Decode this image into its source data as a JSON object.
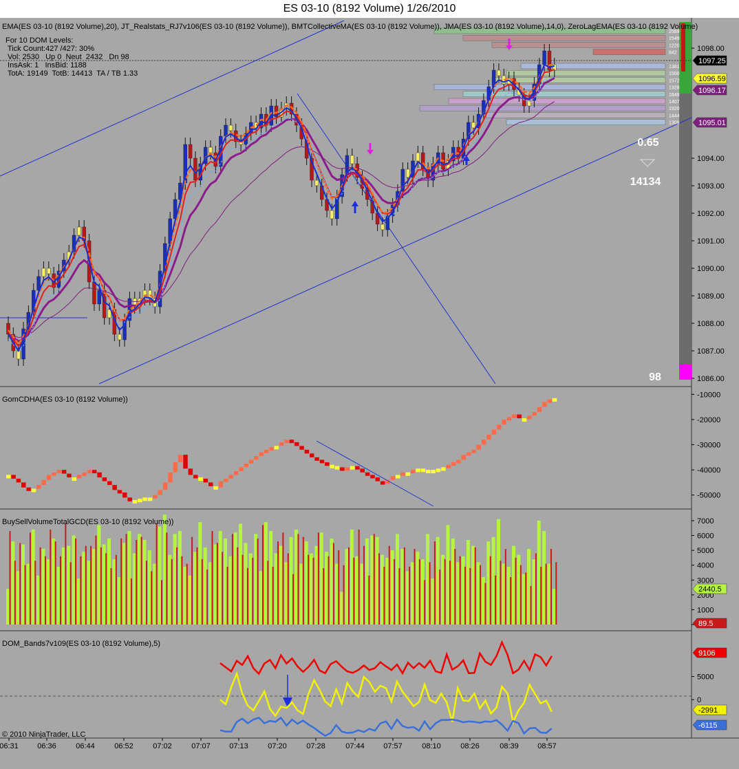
{
  "window": {
    "title": "ES 03-10 (8192 Volume)  1/26/2010"
  },
  "colors": {
    "background": "#a7a7a7",
    "up_bar": "#1a2fb8",
    "down_bar": "#b51a1a",
    "neutral_bar": "#f4ee6c",
    "ema": "#e02020",
    "jma": "#8b1c8b",
    "zlema": "#1530d0",
    "trend_line": "#2233cc",
    "cd_up": "#ff6b4a",
    "cd_down": "#e00000",
    "buy": "#b5f542",
    "sell": "#c81a1a",
    "dom_red": "#ee0000",
    "dom_yellow": "#f3f300",
    "dom_blue": "#3b6fd8"
  },
  "price_panel": {
    "indicator_label": "EMA(ES 03-10 (8192 Volume),20), JT_Realstats_RJ7v106(ES 03-10 (8192 Volume)), BMTCollectiveMA(ES 03-10 (8192 Volume)), JMA(ES 03-10 (8192 Volume),14,0), ZeroLagEMA(ES 03-10 (8192 Volume)",
    "stats": [
      "For 10 DOM Levels:",
      " Tick Count:427 /427: 30%",
      " Vol: 2530   Up 0  Neut  2432   Dn 98",
      " InsAsk: 1   InsBid: 1188",
      " TotA: 19149  TotB: 14413  TA / TB 1.33"
    ],
    "ratio": "0.65",
    "bid_total": "14134",
    "down_volume": "98",
    "dom_levels": [
      "2589",
      "1549",
      "1220",
      "842",
      "",
      "1381",
      "1500",
      "1572",
      "1328",
      "1849",
      "1407",
      "1920",
      "1444",
      "1309"
    ],
    "price_ticks": [
      "1098.00",
      "1094.00",
      "1093.00",
      "1092.00",
      "1091.00",
      "1090.00",
      "1089.00",
      "1088.00",
      "1087.00",
      "1086.00"
    ],
    "markers": [
      {
        "label": "1097.25",
        "color": "#000000",
        "text_color": "#ffffff"
      },
      {
        "label": "1096.59",
        "color": "#ffff33",
        "text_color": "#000000"
      },
      {
        "label": "1096.17",
        "color": "#7d1f7d",
        "text_color": "#ffffff"
      },
      {
        "label": "1095.01",
        "color": "#7d1f7d",
        "text_color": "#ffffff"
      }
    ]
  },
  "cd_panel": {
    "label": "GomCDHA(ES 03-10 (8192 Volume))",
    "ticks": [
      "-10000",
      "-20000",
      "-30000",
      "-40000",
      "-50000"
    ]
  },
  "vol_panel": {
    "label": "BuySellVolumeTotalGCD(ES 03-10 (8192 Volume))",
    "ticks": [
      "7000",
      "6000",
      "5000",
      "4000",
      "3000",
      "2000",
      "1000",
      "0"
    ],
    "markers": [
      {
        "label": "2440.5",
        "color": "#b5f542",
        "text_color": "#000000"
      },
      {
        "label": "89.5",
        "color": "#c81a1a",
        "text_color": "#ffffff"
      }
    ]
  },
  "dom_panel": {
    "label": "DOM_Bands7v109(ES 03-10 (8192 Volume),5)",
    "ticks": [
      "5000",
      "0"
    ],
    "markers": [
      {
        "label": "9106",
        "color": "#ee0000",
        "text_color": "#ffffff"
      },
      {
        "label": "-2991",
        "color": "#f3f300",
        "text_color": "#000000"
      },
      {
        "label": "-6115",
        "color": "#3b6fd8",
        "text_color": "#ffffff"
      }
    ]
  },
  "copyright": "© 2010 NinjaTrader, LLC",
  "time_labels": [
    "06:31",
    "06:36",
    "06:44",
    "06:52",
    "07:02",
    "07:07",
    "07:13",
    "07:20",
    "07:28",
    "07:44",
    "07:57",
    "08:10",
    "08:26",
    "08:39",
    "08:57"
  ],
  "chart_data": {
    "type": "candlestick",
    "title": "ES 03-10 (8192 Volume)  1/26/2010",
    "y_range": [
      1085.7,
      1098.6
    ],
    "closes": [
      1087.6,
      1087.0,
      1086.7,
      1087.8,
      1088.4,
      1089.2,
      1089.7,
      1090.0,
      1089.8,
      1089.3,
      1089.9,
      1090.3,
      1090.6,
      1091.2,
      1091.5,
      1091.0,
      1089.5,
      1088.7,
      1089.2,
      1088.2,
      1088.5,
      1087.6,
      1087.4,
      1088.1,
      1088.9,
      1088.6,
      1088.9,
      1089.2,
      1088.9,
      1088.6,
      1089.9,
      1090.9,
      1091.8,
      1092.5,
      1093.1,
      1094.5,
      1094.0,
      1093.2,
      1093.8,
      1094.4,
      1094.2,
      1093.7,
      1094.8,
      1095.2,
      1095.0,
      1094.6,
      1094.5,
      1094.9,
      1095.3,
      1095.1,
      1095.6,
      1095.2,
      1095.9,
      1095.5,
      1095.8,
      1096.0,
      1095.6,
      1095.2,
      1094.7,
      1094.0,
      1093.2,
      1093.0,
      1092.5,
      1092.1,
      1091.8,
      1092.6,
      1093.4,
      1094.1,
      1093.8,
      1093.3,
      1092.9,
      1092.5,
      1092.0,
      1091.6,
      1091.4,
      1091.9,
      1092.3,
      1092.8,
      1093.6,
      1093.3,
      1093.9,
      1094.2,
      1093.6,
      1093.2,
      1093.8,
      1094.2,
      1093.6,
      1093.9,
      1094.4,
      1094.0,
      1094.7,
      1095.3,
      1095.1,
      1095.6,
      1096.1,
      1096.6,
      1097.2,
      1097.0,
      1096.7,
      1096.9,
      1096.5,
      1096.3,
      1095.9,
      1096.1,
      1096.7,
      1097.4,
      1097.9,
      1097.2,
      1097.4
    ],
    "cd_values": [
      -42000,
      -43500,
      -45000,
      -47000,
      -48000,
      -47500,
      -46000,
      -44000,
      -42000,
      -41000,
      -40000,
      -41500,
      -43000,
      -43000,
      -42000,
      -41000,
      -40000,
      -41000,
      -43000,
      -44500,
      -46000,
      -48000,
      -49000,
      -51000,
      -52500,
      -52000,
      -51500,
      -51000,
      -51000,
      -50000,
      -48000,
      -45000,
      -41000,
      -37000,
      -34000,
      -39500,
      -42000,
      -43000,
      -43500,
      -45000,
      -46500,
      -47000,
      -44500,
      -43500,
      -42000,
      -40500,
      -39000,
      -37500,
      -36000,
      -34500,
      -33000,
      -32000,
      -31000,
      -30500,
      -29000,
      -28000,
      -29000,
      -30500,
      -32000,
      -33500,
      -35000,
      -36000,
      -37000,
      -38000,
      -38500,
      -39000,
      -40000,
      -39000,
      -38500,
      -39500,
      -41000,
      -42000,
      -43000,
      -44500,
      -45500,
      -44000,
      -42500,
      -42000,
      -41000,
      -41000,
      -40000,
      -39500,
      -40000,
      -40500,
      -40000,
      -39500,
      -39000,
      -38000,
      -37000,
      -36000,
      -34000,
      -33000,
      -32000,
      -30000,
      -28000,
      -26000,
      -24000,
      -22000,
      -20000,
      -19000,
      -18000,
      -19500,
      -19500,
      -18500,
      -17000,
      -15000,
      -13000,
      -12000,
      -11500
    ],
    "buy_volume": [
      2400,
      5600,
      3600,
      5400,
      4100,
      6400,
      3300,
      5100,
      4400,
      5800,
      3900,
      5200,
      5300,
      6000,
      3100,
      4900,
      4300,
      5100,
      6700,
      5400,
      5800,
      4400,
      3200,
      5500,
      6300,
      4800,
      6100,
      5700,
      5000,
      4100,
      6600,
      7400,
      4700,
      6100,
      6300,
      3900,
      3300,
      4900,
      6900,
      5200,
      4200,
      5400,
      6300,
      5800,
      4600,
      6200,
      6800,
      5500,
      4800,
      6100,
      3600,
      6900,
      6300,
      4800,
      5300,
      4200,
      5900,
      6400,
      4100,
      5600,
      4800,
      5300,
      6200,
      4900,
      5800,
      4100,
      2200,
      5100,
      6400,
      4600,
      4100,
      5800,
      6000,
      5900,
      4700,
      4500,
      5000,
      6100,
      5100,
      3600,
      4200,
      4900,
      4400,
      6100,
      3100,
      5900,
      4700,
      6700,
      5800,
      4200,
      4600,
      5700,
      5300,
      4200,
      3200,
      5600,
      5900,
      7100,
      4100,
      3900,
      5300,
      4700,
      3400,
      5100,
      4400,
      7000,
      6300,
      4100,
      2400
    ],
    "sell_volume": [
      6300,
      4300,
      5500,
      4000,
      6200,
      4300,
      5200,
      4600,
      6400,
      5600,
      4600,
      6800,
      4200,
      5800,
      4600,
      5300,
      5300,
      6000,
      5200,
      4800,
      3800,
      4700,
      5800,
      6100,
      3100,
      5700,
      5900,
      4300,
      3600,
      6800,
      3000,
      6200,
      4400,
      5200,
      4600,
      4100,
      5900,
      5200,
      4400,
      3700,
      6300,
      5500,
      4900,
      3900,
      6100,
      5200,
      4700,
      3800,
      4500,
      5800,
      6700,
      4300,
      3900,
      5600,
      6200,
      4800,
      3400,
      6100,
      5900,
      4700,
      4500,
      6200,
      3800,
      4600,
      5500,
      5000,
      4000,
      5200,
      4500,
      6400,
      5300,
      3300,
      6100,
      4800,
      3900,
      5300,
      4400,
      3800,
      5200,
      3900,
      5100,
      4400,
      3000,
      4200,
      5600,
      3700,
      4400,
      4300,
      5100,
      4600,
      3900,
      3800,
      5200,
      4000,
      2800,
      4600,
      3300,
      4300,
      5100,
      3200,
      4500,
      4000,
      3500,
      2600,
      4800,
      3900,
      4100,
      5100,
      4200
    ],
    "dom_red": [
      7900,
      7000,
      6100,
      8400,
      7500,
      9400,
      6800,
      5600,
      7800,
      8600,
      6800,
      9600,
      7800,
      8900,
      7200,
      6000,
      7100,
      8600,
      6300,
      5700,
      7700,
      8300,
      7100,
      6100,
      5800,
      6400,
      7400,
      6400,
      6800,
      8100,
      7200,
      6400,
      7600,
      5700,
      8000,
      6800,
      7900,
      6900,
      8400,
      6100,
      5800,
      9800,
      6500,
      7200,
      8500,
      5700,
      5800,
      10000,
      8200,
      7500,
      9400,
      12400,
      9700,
      5700,
      6500,
      8400,
      6400,
      9800,
      9200,
      7400,
      9400
    ],
    "dom_yellow": [
      0,
      -1000,
      2700,
      5600,
      1300,
      -1300,
      -2300,
      -300,
      1800,
      -2000,
      -3500,
      -1500,
      -1800,
      -600,
      -2300,
      -3100,
      1300,
      4200,
      2100,
      -400,
      -1400,
      2200,
      -800,
      3600,
      1800,
      600,
      4900,
      3800,
      1700,
      3000,
      2500,
      -400,
      3900,
      1700,
      200,
      -1400,
      -500,
      3300,
      -100,
      -700,
      1300,
      -600,
      -4800,
      2500,
      -200,
      -300,
      1300,
      -1900,
      -200,
      -3000,
      -1700,
      2800,
      1300,
      -4900,
      -2300,
      -700,
      3200,
      1200,
      -800,
      -200,
      -2600
    ],
    "dom_blue": [
      -6600,
      -6900,
      -6900,
      -4800,
      -4100,
      -5100,
      -4300,
      -3900,
      -5100,
      -4600,
      -4800,
      -3900,
      -5600,
      -4300,
      -5200,
      -4500,
      -5400,
      -6100,
      -7000,
      -7800,
      -7200,
      -5500,
      -6900,
      -7200,
      -7100,
      -6600,
      -7000,
      -6300,
      -6700,
      -5100,
      -4700,
      -6300,
      -4300,
      -5700,
      -6100,
      -5900,
      -6700,
      -4700,
      -6400,
      -5100,
      -4400,
      -4400,
      -4300,
      -4500,
      -4900,
      -4700,
      -4800,
      -5000,
      -4700,
      -4800,
      -4400,
      -5400,
      -6700,
      -4600,
      -5100,
      -7300,
      -6200,
      -6100,
      -7100,
      -7200,
      -6200
    ]
  }
}
